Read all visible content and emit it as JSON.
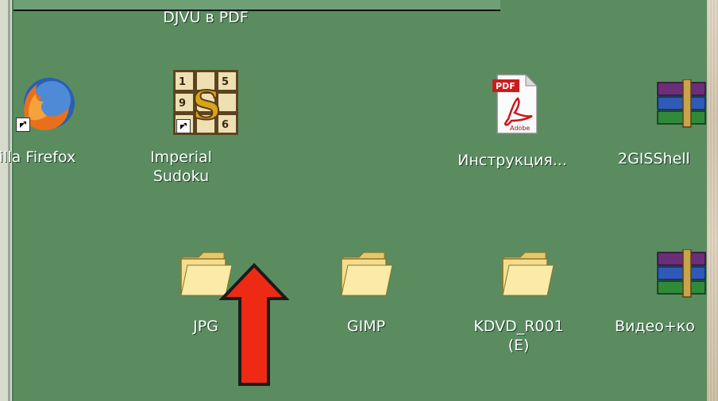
{
  "desktop": {
    "background_color": "#5a8c60",
    "icons": [
      {
        "label": "DJVU в PDF",
        "kind": "shortcut"
      },
      {
        "label": "zilla Firefox",
        "kind": "firefox-shortcut"
      },
      {
        "label": "Imperial\nSudoku",
        "kind": "sudoku-shortcut"
      },
      {
        "label": "Инструкция...",
        "kind": "pdf-document"
      },
      {
        "label": "2GISShell",
        "kind": "rar-archive"
      },
      {
        "label": "JPG",
        "kind": "folder"
      },
      {
        "label": "GIMP",
        "kind": "folder"
      },
      {
        "label": "KDVD_R001\n(E)",
        "kind": "folder"
      },
      {
        "label": "Видео+ко",
        "kind": "rar-archive"
      }
    ]
  },
  "annotation": {
    "arrow_color": "#ee2a14",
    "arrow_direction": "up",
    "points_to": "JPG"
  },
  "colors": {
    "label_text": "#ffffff",
    "folder": "#f3dc8c",
    "arrow": "#ee2a14"
  }
}
